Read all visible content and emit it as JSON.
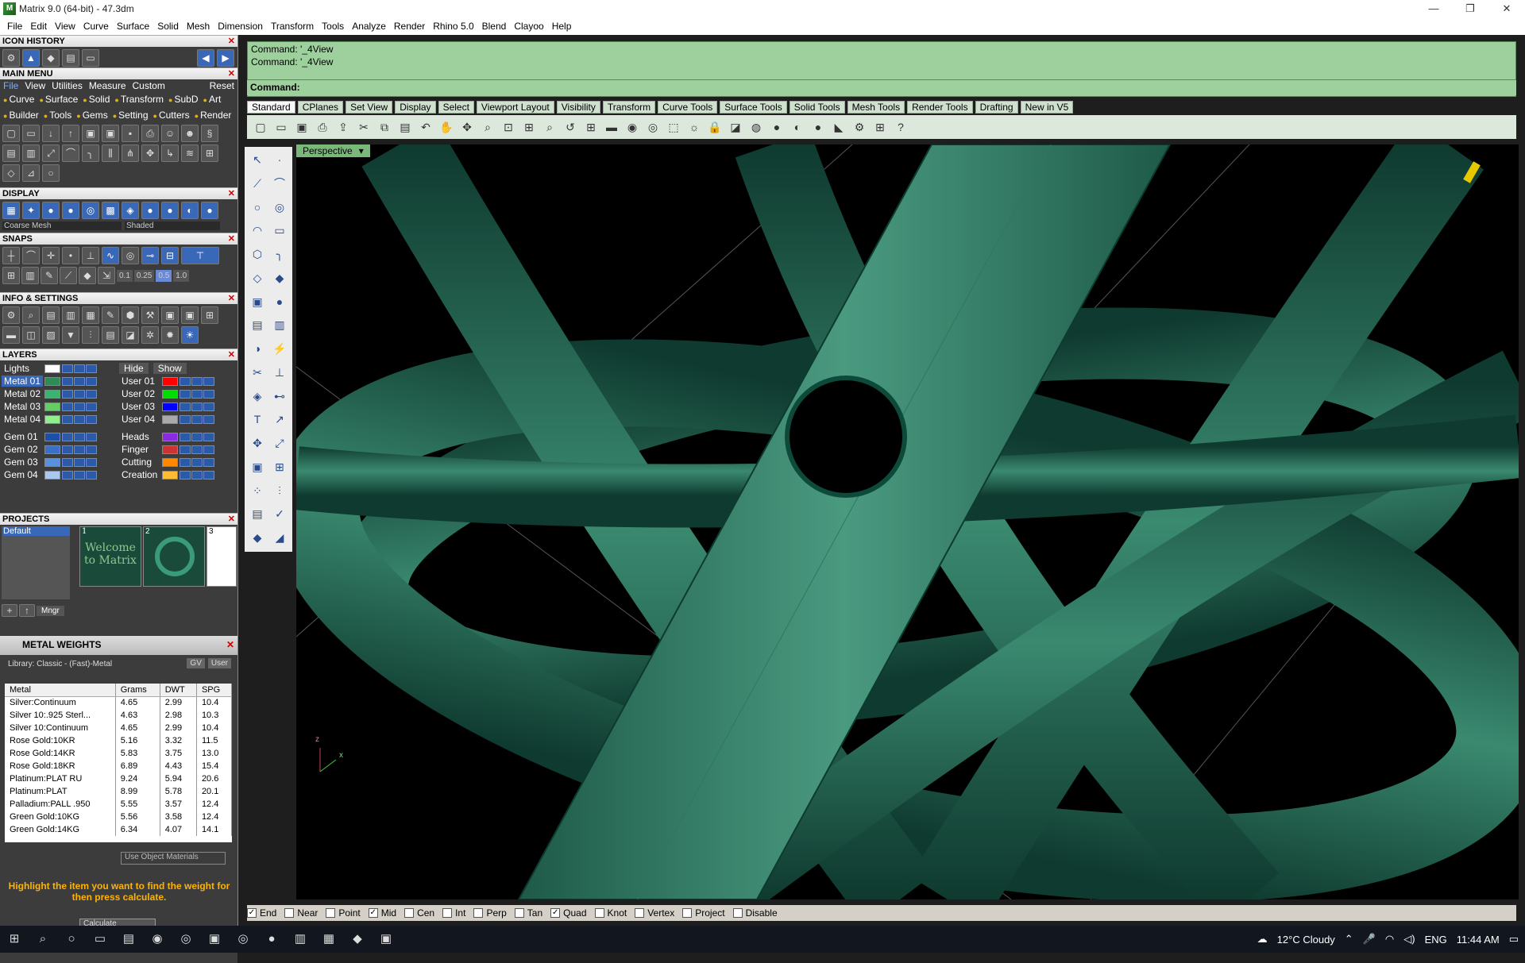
{
  "window": {
    "title": "Matrix 9.0 (64-bit) - 47.3dm",
    "controls": [
      "—",
      "❐",
      "✕"
    ]
  },
  "menu": [
    "File",
    "Edit",
    "View",
    "Curve",
    "Surface",
    "Solid",
    "Mesh",
    "Dimension",
    "Transform",
    "Tools",
    "Analyze",
    "Render",
    "Rhino 5.0",
    "Blend",
    "Clayoo",
    "Help"
  ],
  "left": {
    "icon_history": "ICON HISTORY",
    "main_menu": "MAIN MENU",
    "main_tabs": [
      "File",
      "View",
      "Utilities",
      "Measure",
      "Custom",
      "Reset"
    ],
    "categories": [
      "Curve",
      "Surface",
      "Solid",
      "Transform",
      "SubD",
      "Art",
      "Builder",
      "Tools",
      "Gems",
      "Setting",
      "Cutters",
      "Render"
    ],
    "display": "DISPLAY",
    "display_modes": [
      "Coarse Mesh",
      "Shaded"
    ],
    "snaps": "SNAPS",
    "snap_values": [
      "0.1",
      "0.25",
      "0.5",
      "1.0"
    ],
    "info": "INFO & SETTINGS",
    "layers_title": "LAYERS",
    "layers": {
      "hide": "Hide",
      "show": "Show",
      "left": [
        {
          "name": "Lights",
          "color": "#ffffff"
        },
        {
          "name": "Metal 01",
          "color": "#2e8b57"
        },
        {
          "name": "Metal 02",
          "color": "#3cb371"
        },
        {
          "name": "Metal 03",
          "color": "#66cd66"
        },
        {
          "name": "Metal 04",
          "color": "#90ee90"
        },
        {
          "name": "Gem 01",
          "color": "#1e4fa8"
        },
        {
          "name": "Gem 02",
          "color": "#3a70c8"
        },
        {
          "name": "Gem 03",
          "color": "#5a90e0"
        },
        {
          "name": "Gem 04",
          "color": "#a8c8f0"
        }
      ],
      "right": [
        {
          "name": "User 01",
          "color": "#ff0000"
        },
        {
          "name": "User 02",
          "color": "#00dd00"
        },
        {
          "name": "User 03",
          "color": "#0000ff"
        },
        {
          "name": "User 04",
          "color": "#aaaaaa"
        },
        {
          "name": "Heads",
          "color": "#8a2be2"
        },
        {
          "name": "Finger",
          "color": "#cc3333"
        },
        {
          "name": "Cutting",
          "color": "#ff8800"
        },
        {
          "name": "Creation",
          "color": "#ffbb33"
        }
      ]
    },
    "projects_title": "PROJECTS",
    "projects": {
      "default": "Default",
      "thumb_nums": [
        "1",
        "2",
        "3"
      ],
      "welcome": "Welcome to Matrix",
      "mngr": "Mngr"
    },
    "weights_title": "METAL WEIGHTS",
    "library": "Library: Classic - (Fast)-Metal",
    "gv": "GV",
    "user": "User",
    "table_headers": [
      "Metal",
      "Grams",
      "DWT",
      "SPG"
    ],
    "table_rows": [
      [
        "Silver:Continuum",
        "4.65",
        "2.99",
        "10.4"
      ],
      [
        "Silver 10:.925 Sterl...",
        "4.63",
        "2.98",
        "10.3"
      ],
      [
        "Silver 10:Continuum",
        "4.65",
        "2.99",
        "10.4"
      ],
      [
        "Rose Gold:10KR",
        "5.16",
        "3.32",
        "11.5"
      ],
      [
        "Rose Gold:14KR",
        "5.83",
        "3.75",
        "13.0"
      ],
      [
        "Rose Gold:18KR",
        "6.89",
        "4.43",
        "15.4"
      ],
      [
        "Platinum:PLAT RU",
        "9.24",
        "5.94",
        "20.6"
      ],
      [
        "Platinum:PLAT",
        "8.99",
        "5.78",
        "20.1"
      ],
      [
        "Palladium:PALL .950",
        "5.55",
        "3.57",
        "12.4"
      ],
      [
        "Green Gold:10KG",
        "5.56",
        "3.58",
        "12.4"
      ],
      [
        "Green Gold:14KG",
        "6.34",
        "4.07",
        "14.1"
      ]
    ],
    "use_materials": "Use Object Materials",
    "hint": "Highlight the item you want to find the weight for then press calculate.",
    "calculate": "Calculate"
  },
  "command": {
    "history": [
      "Command: '_4View",
      "Command: '_4View"
    ],
    "prompt": "Command:"
  },
  "tool_tabs": [
    "Standard",
    "CPlanes",
    "Set View",
    "Display",
    "Select",
    "Viewport Layout",
    "Visibility",
    "Transform",
    "Curve Tools",
    "Surface Tools",
    "Solid Tools",
    "Mesh Tools",
    "Render Tools",
    "Drafting",
    "New in V5"
  ],
  "viewport": {
    "label": "Perspective",
    "axes": [
      "z",
      "x"
    ]
  },
  "osnaps": [
    {
      "label": "End",
      "checked": true
    },
    {
      "label": "Near",
      "checked": false
    },
    {
      "label": "Point",
      "checked": false
    },
    {
      "label": "Mid",
      "checked": true
    },
    {
      "label": "Cen",
      "checked": false
    },
    {
      "label": "Int",
      "checked": false
    },
    {
      "label": "Perp",
      "checked": false
    },
    {
      "label": "Tan",
      "checked": false
    },
    {
      "label": "Quad",
      "checked": true
    },
    {
      "label": "Knot",
      "checked": false
    },
    {
      "label": "Vertex",
      "checked": false
    },
    {
      "label": "Project",
      "checked": false
    },
    {
      "label": "Disable",
      "checked": false
    }
  ],
  "taskbar": {
    "weather": "12°C Cloudy",
    "lang": "ENG",
    "time": "11:44 AM"
  }
}
